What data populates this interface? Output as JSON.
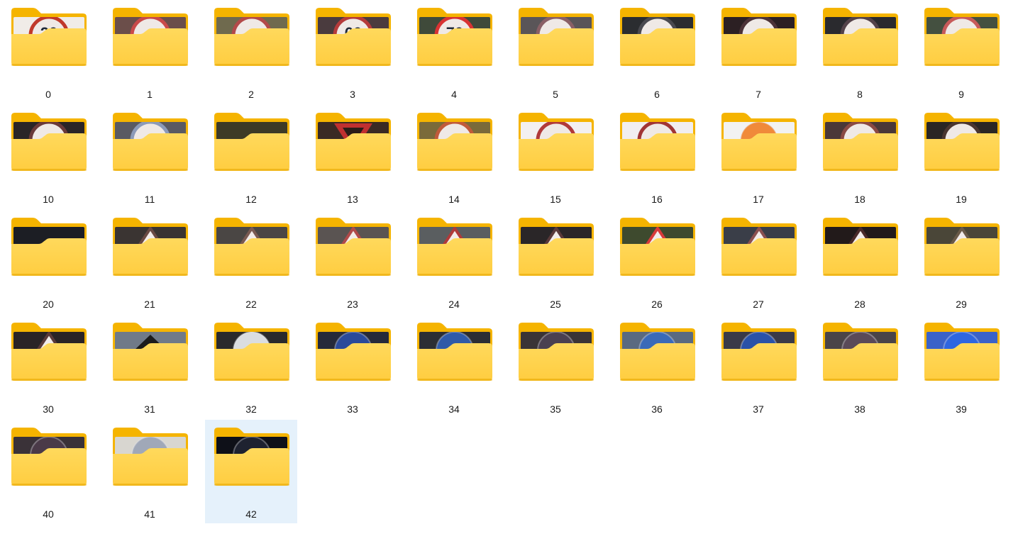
{
  "folders": [
    {
      "label": "0",
      "icon": "folder-icon",
      "thumb": {
        "bg": "#f0ece8",
        "mark": "ring",
        "color": "#c0392b",
        "text": "20"
      }
    },
    {
      "label": "1",
      "icon": "folder-icon",
      "thumb": {
        "bg": "#6b4e4a",
        "mark": "ring",
        "color": "#c94a4a"
      }
    },
    {
      "label": "2",
      "icon": "folder-icon",
      "thumb": {
        "bg": "#6f6a4e",
        "mark": "ring",
        "color": "#b34a4a"
      }
    },
    {
      "label": "3",
      "icon": "folder-icon",
      "thumb": {
        "bg": "#4a3b3e",
        "mark": "ring",
        "color": "#b53b3b",
        "text": "60"
      }
    },
    {
      "label": "4",
      "icon": "folder-icon",
      "thumb": {
        "bg": "#3f4a3a",
        "mark": "ring",
        "color": "#d83333",
        "text": "70"
      }
    },
    {
      "label": "5",
      "icon": "folder-icon",
      "thumb": {
        "bg": "#5a5558",
        "mark": "ring",
        "color": "#8a6066"
      }
    },
    {
      "label": "6",
      "icon": "folder-icon",
      "thumb": {
        "bg": "#2b2d30",
        "mark": "ring",
        "color": "#4a4a50"
      }
    },
    {
      "label": "7",
      "icon": "folder-icon",
      "thumb": {
        "bg": "#2c2023",
        "mark": "ring",
        "color": "#4d3338"
      }
    },
    {
      "label": "8",
      "icon": "folder-icon",
      "thumb": {
        "bg": "#2a2a2e",
        "mark": "ring",
        "color": "#54434a"
      }
    },
    {
      "label": "9",
      "icon": "folder-icon",
      "thumb": {
        "bg": "#445040",
        "mark": "ring",
        "color": "#c75a5a"
      }
    },
    {
      "label": "10",
      "icon": "folder-icon",
      "thumb": {
        "bg": "#2a2527",
        "mark": "ring",
        "color": "#6a3a3a"
      }
    },
    {
      "label": "11",
      "icon": "folder-icon",
      "thumb": {
        "bg": "#5a5a62",
        "mark": "ring",
        "color": "#8c9ab8"
      }
    },
    {
      "label": "12",
      "icon": "folder-icon",
      "thumb": {
        "bg": "#3d3a26",
        "mark": "none",
        "color": "#5a5a30"
      }
    },
    {
      "label": "13",
      "icon": "folder-icon",
      "thumb": {
        "bg": "#3a2a24",
        "mark": "tri-down",
        "color": "#c03030"
      }
    },
    {
      "label": "14",
      "icon": "folder-icon",
      "thumb": {
        "bg": "#7a6a3a",
        "mark": "ring",
        "color": "#c05a3a"
      }
    },
    {
      "label": "15",
      "icon": "folder-icon",
      "thumb": {
        "bg": "#f3f0f0",
        "mark": "ring",
        "color": "#b03a3a"
      }
    },
    {
      "label": "16",
      "icon": "folder-icon",
      "thumb": {
        "bg": "#f1eef0",
        "mark": "ring",
        "color": "#a03535"
      }
    },
    {
      "label": "17",
      "icon": "folder-icon",
      "thumb": {
        "bg": "#f2f2f2",
        "mark": "disc",
        "color": "#f08a3a"
      }
    },
    {
      "label": "18",
      "icon": "folder-icon",
      "thumb": {
        "bg": "#4a3838",
        "mark": "ring",
        "color": "#8a4a44"
      }
    },
    {
      "label": "19",
      "icon": "folder-icon",
      "thumb": {
        "bg": "#2a2624",
        "mark": "ring",
        "color": "#4a3630"
      }
    },
    {
      "label": "20",
      "icon": "folder-icon",
      "thumb": {
        "bg": "#1c1e24",
        "mark": "none",
        "color": "#2a2c34"
      }
    },
    {
      "label": "21",
      "icon": "folder-icon",
      "thumb": {
        "bg": "#3a3432",
        "mark": "tri",
        "color": "#6a4a44"
      }
    },
    {
      "label": "22",
      "icon": "folder-icon",
      "thumb": {
        "bg": "#4a4644",
        "mark": "tri",
        "color": "#7a5a52"
      }
    },
    {
      "label": "23",
      "icon": "folder-icon",
      "thumb": {
        "bg": "#5a5452",
        "mark": "tri",
        "color": "#b04a4a"
      }
    },
    {
      "label": "24",
      "icon": "folder-icon",
      "thumb": {
        "bg": "#5a5e60",
        "mark": "tri",
        "color": "#b03a3a"
      }
    },
    {
      "label": "25",
      "icon": "folder-icon",
      "thumb": {
        "bg": "#2a2628",
        "mark": "tri",
        "color": "#5a3a3a"
      }
    },
    {
      "label": "26",
      "icon": "folder-icon",
      "thumb": {
        "bg": "#3e4a2e",
        "mark": "tri",
        "color": "#d83a3a"
      }
    },
    {
      "label": "27",
      "icon": "folder-icon",
      "thumb": {
        "bg": "#3a3e48",
        "mark": "tri",
        "color": "#8a5050"
      }
    },
    {
      "label": "28",
      "icon": "folder-icon",
      "thumb": {
        "bg": "#221a1a",
        "mark": "tri",
        "color": "#4a2a2a"
      }
    },
    {
      "label": "29",
      "icon": "folder-icon",
      "thumb": {
        "bg": "#4a4638",
        "mark": "tri",
        "color": "#6a5a48"
      }
    },
    {
      "label": "30",
      "icon": "folder-icon",
      "thumb": {
        "bg": "#2a2426",
        "mark": "tri",
        "color": "#5a3a3a"
      }
    },
    {
      "label": "31",
      "icon": "folder-icon",
      "thumb": {
        "bg": "#707a88",
        "mark": "diamond",
        "color": "#1c1c1c"
      }
    },
    {
      "label": "32",
      "icon": "folder-icon",
      "thumb": {
        "bg": "#2a2a2c",
        "mark": "disc",
        "color": "#dadde0"
      }
    },
    {
      "label": "33",
      "icon": "folder-icon",
      "thumb": {
        "bg": "#262a3a",
        "mark": "disc",
        "color": "#2a4a9a"
      }
    },
    {
      "label": "34",
      "icon": "folder-icon",
      "thumb": {
        "bg": "#2c2e34",
        "mark": "disc",
        "color": "#2f5aa8"
      }
    },
    {
      "label": "35",
      "icon": "folder-icon",
      "thumb": {
        "bg": "#3a3436",
        "mark": "disc",
        "color": "#4a4050"
      }
    },
    {
      "label": "36",
      "icon": "folder-icon",
      "thumb": {
        "bg": "#5a6a80",
        "mark": "disc",
        "color": "#3a6ab8"
      }
    },
    {
      "label": "37",
      "icon": "folder-icon",
      "thumb": {
        "bg": "#3a3a48",
        "mark": "disc",
        "color": "#2a52a8"
      }
    },
    {
      "label": "38",
      "icon": "folder-icon",
      "thumb": {
        "bg": "#4a4448",
        "mark": "disc",
        "color": "#5a4a58"
      }
    },
    {
      "label": "39",
      "icon": "folder-icon",
      "thumb": {
        "bg": "#3a62c8",
        "mark": "disc",
        "color": "#2e66e0"
      }
    },
    {
      "label": "40",
      "icon": "folder-icon",
      "thumb": {
        "bg": "#3a3238",
        "mark": "disc",
        "color": "#4a3a48"
      }
    },
    {
      "label": "41",
      "icon": "folder-icon",
      "thumb": {
        "bg": "#d8d6d0",
        "mark": "disc",
        "color": "#a0a8b8"
      }
    },
    {
      "label": "42",
      "icon": "folder-icon",
      "selected": true,
      "thumb": {
        "bg": "#0e1018",
        "mark": "disc",
        "color": "#1e2230"
      }
    }
  ],
  "colors": {
    "folder_back": "#f5b400",
    "folder_front": "#ffcd40",
    "folder_front_light": "#ffd95c",
    "selection": "#e5f1fb",
    "label": "#1a1a1a"
  }
}
